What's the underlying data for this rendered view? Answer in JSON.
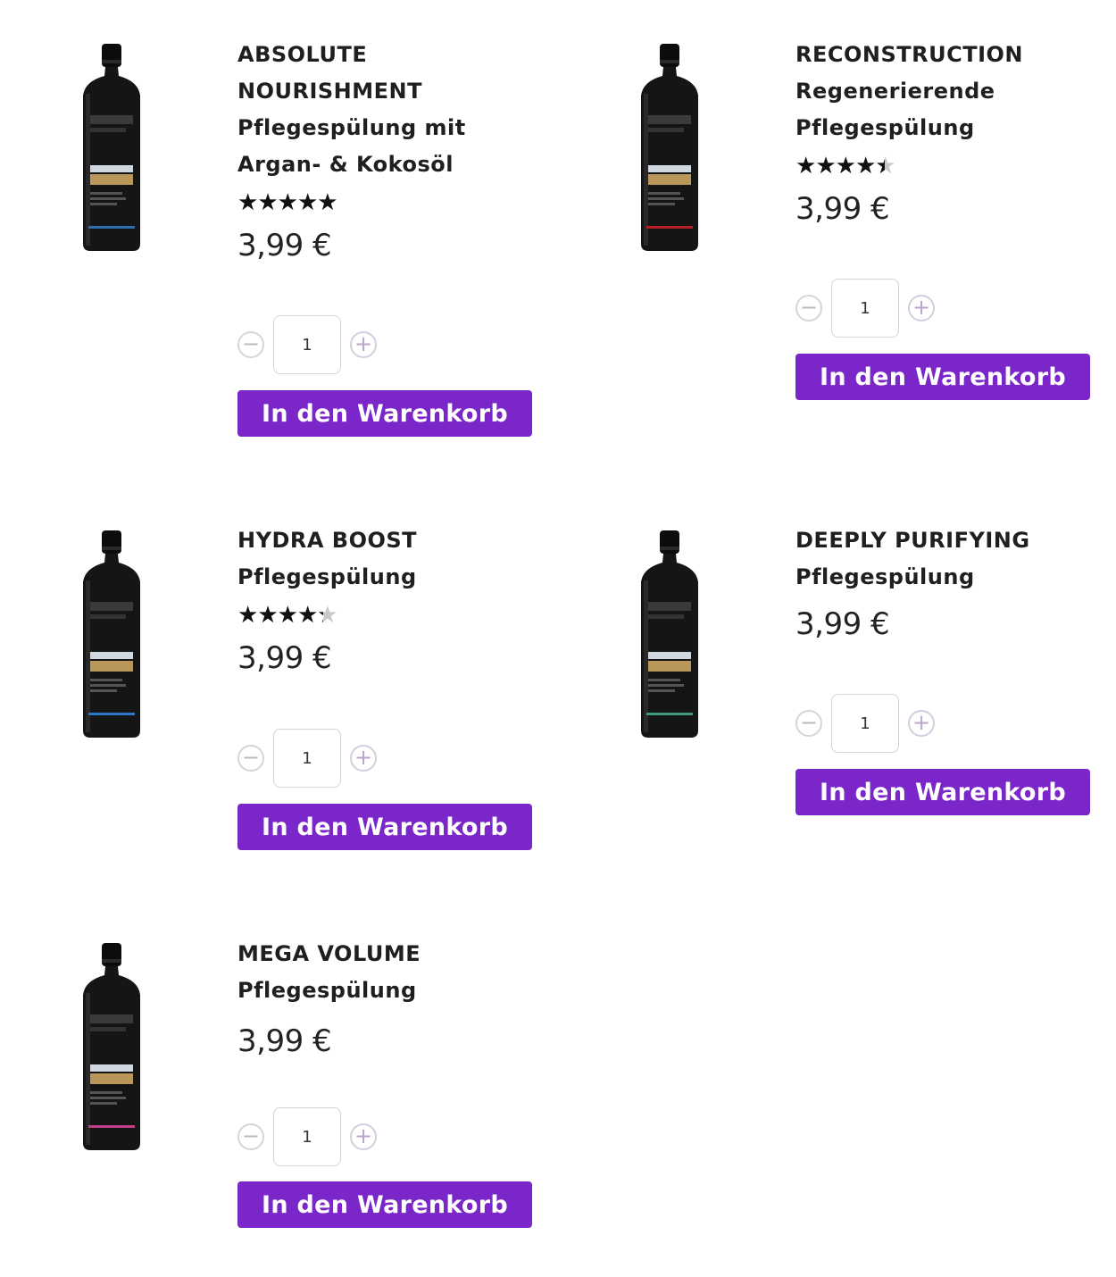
{
  "currency_price": "3,99 €",
  "colors": {
    "accent": "#7a26c9"
  },
  "products": [
    {
      "title_lines": [
        "ABSOLUTE",
        "NOURISHMENT",
        "Pflegespülung mit",
        "Argan- & Kokosöl"
      ],
      "rating": 5,
      "price": "3,99 €",
      "quantity": "1",
      "cart_label": "In den Warenkorb",
      "stripe_color": "#2f6fb0"
    },
    {
      "title_lines": [
        "RECONSTRUCTION",
        "Regenerierende",
        "Pflegespülung"
      ],
      "rating": 4.5,
      "price": "3,99 €",
      "quantity": "1",
      "cart_label": "In den Warenkorb",
      "stripe_color": "#b81d2a"
    },
    {
      "title_lines": [
        "HYDRA BOOST",
        "Pflegespülung"
      ],
      "rating": 4.3,
      "price": "3,99 €",
      "quantity": "1",
      "cart_label": "In den Warenkorb",
      "stripe_color": "#2a76c8"
    },
    {
      "title_lines": [
        "DEEPLY PURIFYING",
        "Pflegespülung"
      ],
      "rating": null,
      "price": "3,99 €",
      "quantity": "1",
      "cart_label": "In den Warenkorb",
      "stripe_color": "#3f9a78"
    },
    {
      "title_lines": [
        "MEGA VOLUME",
        "Pflegespülung"
      ],
      "rating": null,
      "price": "3,99 €",
      "quantity": "1",
      "cart_label": "In den Warenkorb",
      "stripe_color": "#c23d8a"
    }
  ]
}
